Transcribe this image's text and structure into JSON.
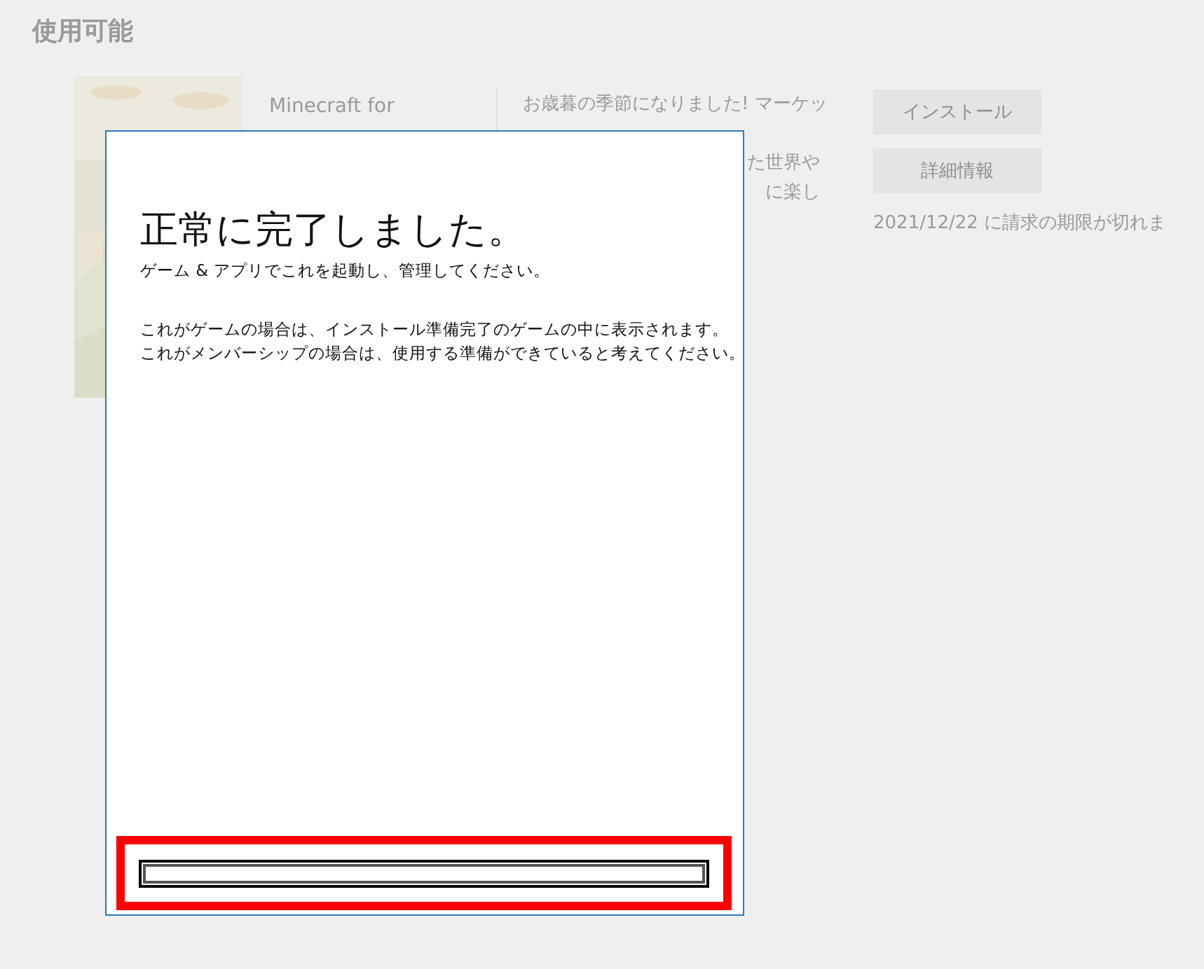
{
  "page": {
    "heading": "使用可能"
  },
  "product": {
    "title_lines": [
      "Minecraft for"
    ],
    "description_lines": [
      "お歳暮の季節になりました! マーケッ"
    ],
    "description_tail_lines": [
      "た世界や",
      "に楽し"
    ],
    "buttons": [
      "インストール",
      "詳細情報"
    ],
    "expiry": "2021/12/22 に請求の期限が切れま"
  },
  "dialog": {
    "title": "正常に完了しました。",
    "subtitle": "ゲーム & アプリでこれを起動し、管理してください。",
    "body_lines": [
      "これがゲームの場合は、インストール準備完了のゲームの中に表示されます。",
      "これがメンバーシップの場合は、使用する準備ができていると考えてください。"
    ],
    "highlighted": true
  }
}
